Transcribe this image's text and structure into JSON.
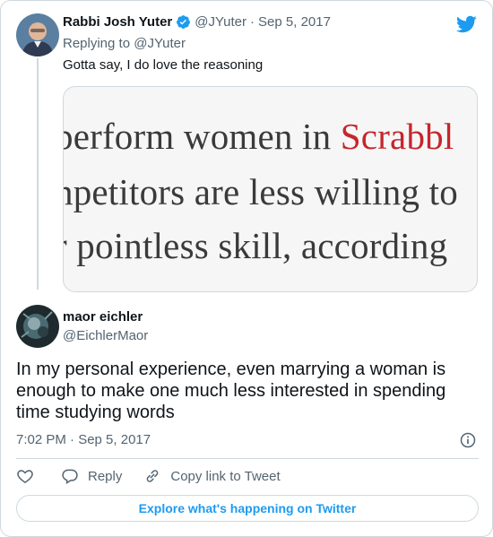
{
  "tweet_parent": {
    "author_name": "Rabbi Josh Yuter",
    "author_handle": "@JYuter",
    "separator": "·",
    "date": "Sep 5, 2017",
    "replying_to": "Replying to @JYuter",
    "text": "Gotta say, I do love the reasoning",
    "media_text": [
      {
        "before": "perform women in ",
        "highlight": "Scrabbl",
        "after": ""
      },
      {
        "before": "npetitors are less willing to",
        "highlight": "",
        "after": ""
      },
      {
        "before": "r pointless skill, according",
        "highlight": "",
        "after": ""
      }
    ]
  },
  "tweet_main": {
    "author_name": "maor eichler",
    "author_handle": "@EichlerMaor",
    "text": "In my personal experience, even marrying a woman is enough to make one much less interested in spending time studying words",
    "timestamp": "7:02 PM · Sep 5, 2017"
  },
  "actions": {
    "reply_label": "Reply",
    "copy_link_label": "Copy link to Tweet"
  },
  "footer": {
    "explore_label": "Explore what's happening on Twitter"
  },
  "colors": {
    "accent": "#1d9bf0",
    "text_primary": "#0f1419",
    "text_secondary": "#536471",
    "border": "#cfd9de",
    "highlight_red": "#c5262c"
  },
  "icons": [
    "twitter-bird-icon",
    "verified-badge-icon",
    "info-icon",
    "heart-icon",
    "reply-icon",
    "link-icon"
  ]
}
